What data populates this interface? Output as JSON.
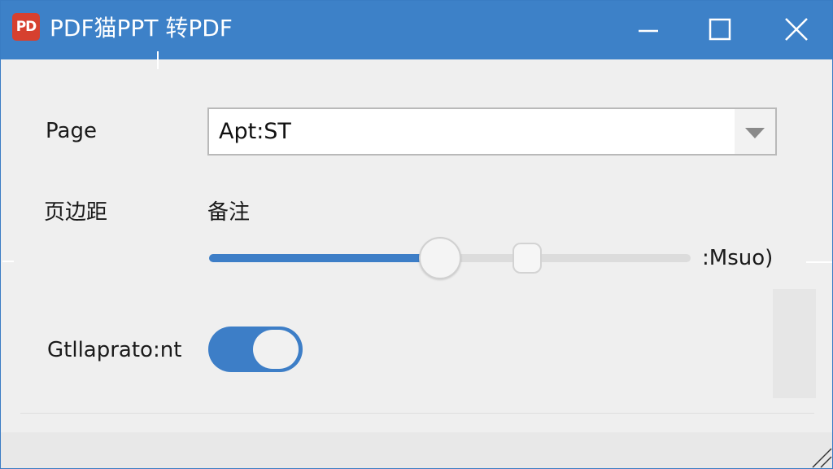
{
  "window": {
    "app_icon_text": "PD",
    "title": "PDF猫PPT 转PDF",
    "controls": {
      "minimize_icon": "minimize-icon",
      "maximize_icon": "maximize-icon",
      "close_icon": "close-icon"
    }
  },
  "form": {
    "page": {
      "label": "Page",
      "value": "Apt:ST"
    },
    "margin": {
      "label": "页边距",
      "notes_label": "备注",
      "slider_value_text": ":Msuo)",
      "fill_fraction": 0.48,
      "secondary_fraction": 0.66
    },
    "toggle": {
      "label": "Gtllaprato:nt",
      "on": true
    }
  },
  "colors": {
    "accent": "#3d81c8",
    "app_icon": "#d6402f"
  }
}
